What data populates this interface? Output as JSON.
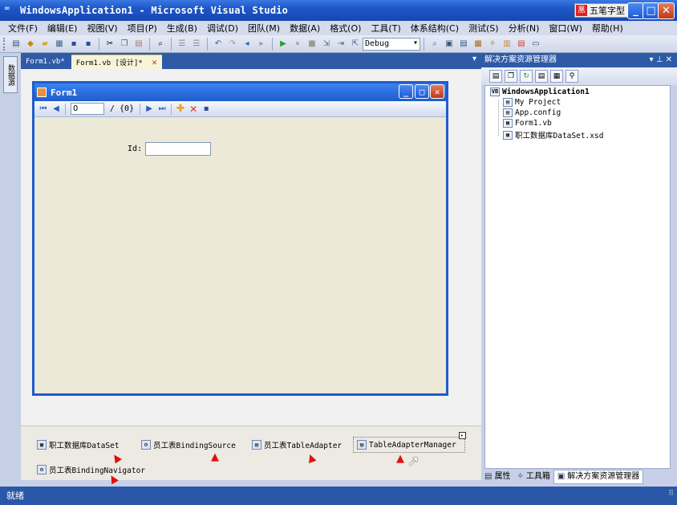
{
  "window": {
    "title": "WindowsApplication1 - Microsoft Visual Studio",
    "ime_label": "五笔字型",
    "ime_logo": "凰",
    "minimize": "_",
    "maximize": "□",
    "close": "✕"
  },
  "menu": [
    "文件(F)",
    "编辑(E)",
    "视图(V)",
    "项目(P)",
    "生成(B)",
    "调试(D)",
    "团队(M)",
    "数据(A)",
    "格式(O)",
    "工具(T)",
    "体系结构(C)",
    "测试(S)",
    "分析(N)",
    "窗口(W)",
    "帮助(H)"
  ],
  "toolbar": {
    "config_value": "Debug"
  },
  "left_strip": {
    "tab_label": "数据源"
  },
  "doc_tabs": [
    {
      "label": "Form1.vb*",
      "active": false
    },
    {
      "label": "Form1.vb [设计]*",
      "active": true
    }
  ],
  "doc_tab_close": "✕",
  "doc_tab_dropdown": "▾",
  "form": {
    "title": "Form1",
    "navigator": {
      "position": "0",
      "count": "/ {0}"
    },
    "id_label": "Id:"
  },
  "tray": {
    "items": [
      {
        "label": "职工数据库DataSet",
        "icon": "dataset-icon"
      },
      {
        "label": "员工表BindingSource",
        "icon": "binding-source-icon"
      },
      {
        "label": "员工表TableAdapter",
        "icon": "table-adapter-icon"
      },
      {
        "label": "TableAdapterManager",
        "icon": "adapter-manager-icon",
        "selected": true
      },
      {
        "label": "员工表BindingNavigator",
        "icon": "binding-navigator-icon"
      }
    ]
  },
  "solution_explorer": {
    "title": "解决方案资源管理器",
    "title_controls": "▾ ⊥ ✕",
    "tree": [
      {
        "label": "WindowsApplication1",
        "level": 0
      },
      {
        "label": "My Project",
        "level": 1
      },
      {
        "label": "App.config",
        "level": 1
      },
      {
        "label": "Form1.vb",
        "level": 1
      },
      {
        "label": "职工数据库DataSet.xsd",
        "level": 1
      }
    ],
    "bottom_tabs": [
      {
        "label": "属性",
        "icon": "properties-icon",
        "active": false
      },
      {
        "label": "工具箱",
        "icon": "toolbox-icon",
        "active": false
      },
      {
        "label": "解决方案资源管理器",
        "icon": "solution-explorer-icon",
        "active": true
      }
    ]
  },
  "status": {
    "text": "就绪"
  },
  "colors": {
    "title_bar": "#1d56c9",
    "annotation_arrow": "#e01010",
    "form_border": "#1f5ccc"
  }
}
